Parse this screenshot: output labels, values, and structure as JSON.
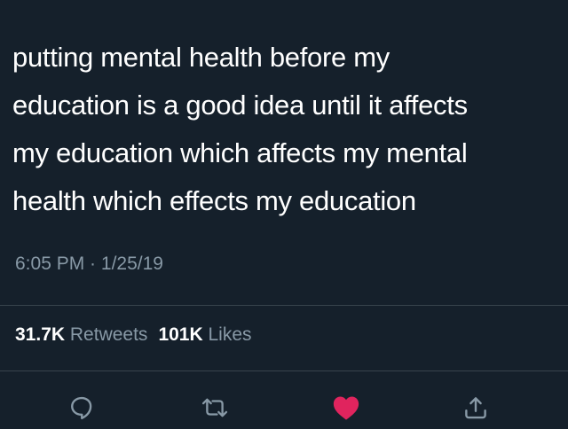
{
  "tweet": {
    "text": "putting mental health before my\neducation is a good idea until it affects\nmy education which affects my mental\nhealth which effects my education",
    "time": "6:05 PM",
    "separator": " · ",
    "date": "1/25/19"
  },
  "stats": {
    "retweets_count": "31.7K",
    "retweets_label": "Retweets",
    "likes_count": "101K",
    "likes_label": "Likes"
  },
  "actions": {
    "reply_icon": "comment-bubble-icon",
    "retweet_icon": "retweet-arrows-icon",
    "like_icon": "heart-icon",
    "share_icon": "share-upload-icon",
    "liked": true
  },
  "colors": {
    "background": "#15202b",
    "text": "#ffffff",
    "secondary_text": "#8899a6",
    "divider": "#38444d",
    "like": "#e0245e"
  }
}
